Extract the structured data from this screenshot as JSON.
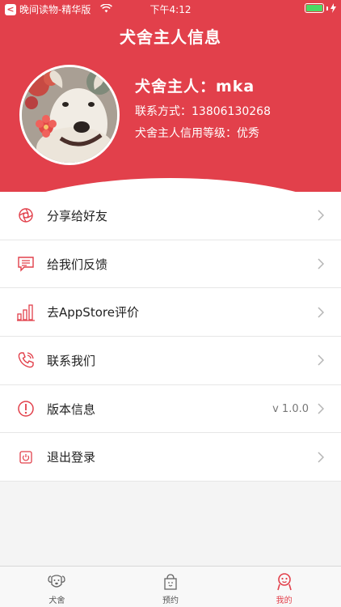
{
  "status_bar": {
    "carrier": "晚间读物-精华版",
    "time": "下午4:12"
  },
  "header": {
    "title": "犬舍主人信息",
    "owner_name": "犬舍主人：mka",
    "contact": "联系方式：13806130268",
    "credit": "犬舍主人信用等级：优秀"
  },
  "menu": {
    "items": [
      {
        "label": "分享给好友",
        "icon": "share-icon"
      },
      {
        "label": "给我们反馈",
        "icon": "feedback-icon"
      },
      {
        "label": "去AppStore评价",
        "icon": "rating-icon"
      },
      {
        "label": "联系我们",
        "icon": "phone-icon"
      },
      {
        "label": "版本信息",
        "icon": "info-icon",
        "value": "v 1.0.0"
      },
      {
        "label": "退出登录",
        "icon": "power-icon"
      }
    ]
  },
  "tabbar": {
    "tabs": [
      {
        "label": "犬舍",
        "icon": "dog-icon"
      },
      {
        "label": "预约",
        "icon": "reservation-icon"
      },
      {
        "label": "我的",
        "icon": "profile-icon"
      }
    ],
    "active_index": 2
  },
  "colors": {
    "accent": "#e2404b",
    "battery": "#4cd964"
  }
}
